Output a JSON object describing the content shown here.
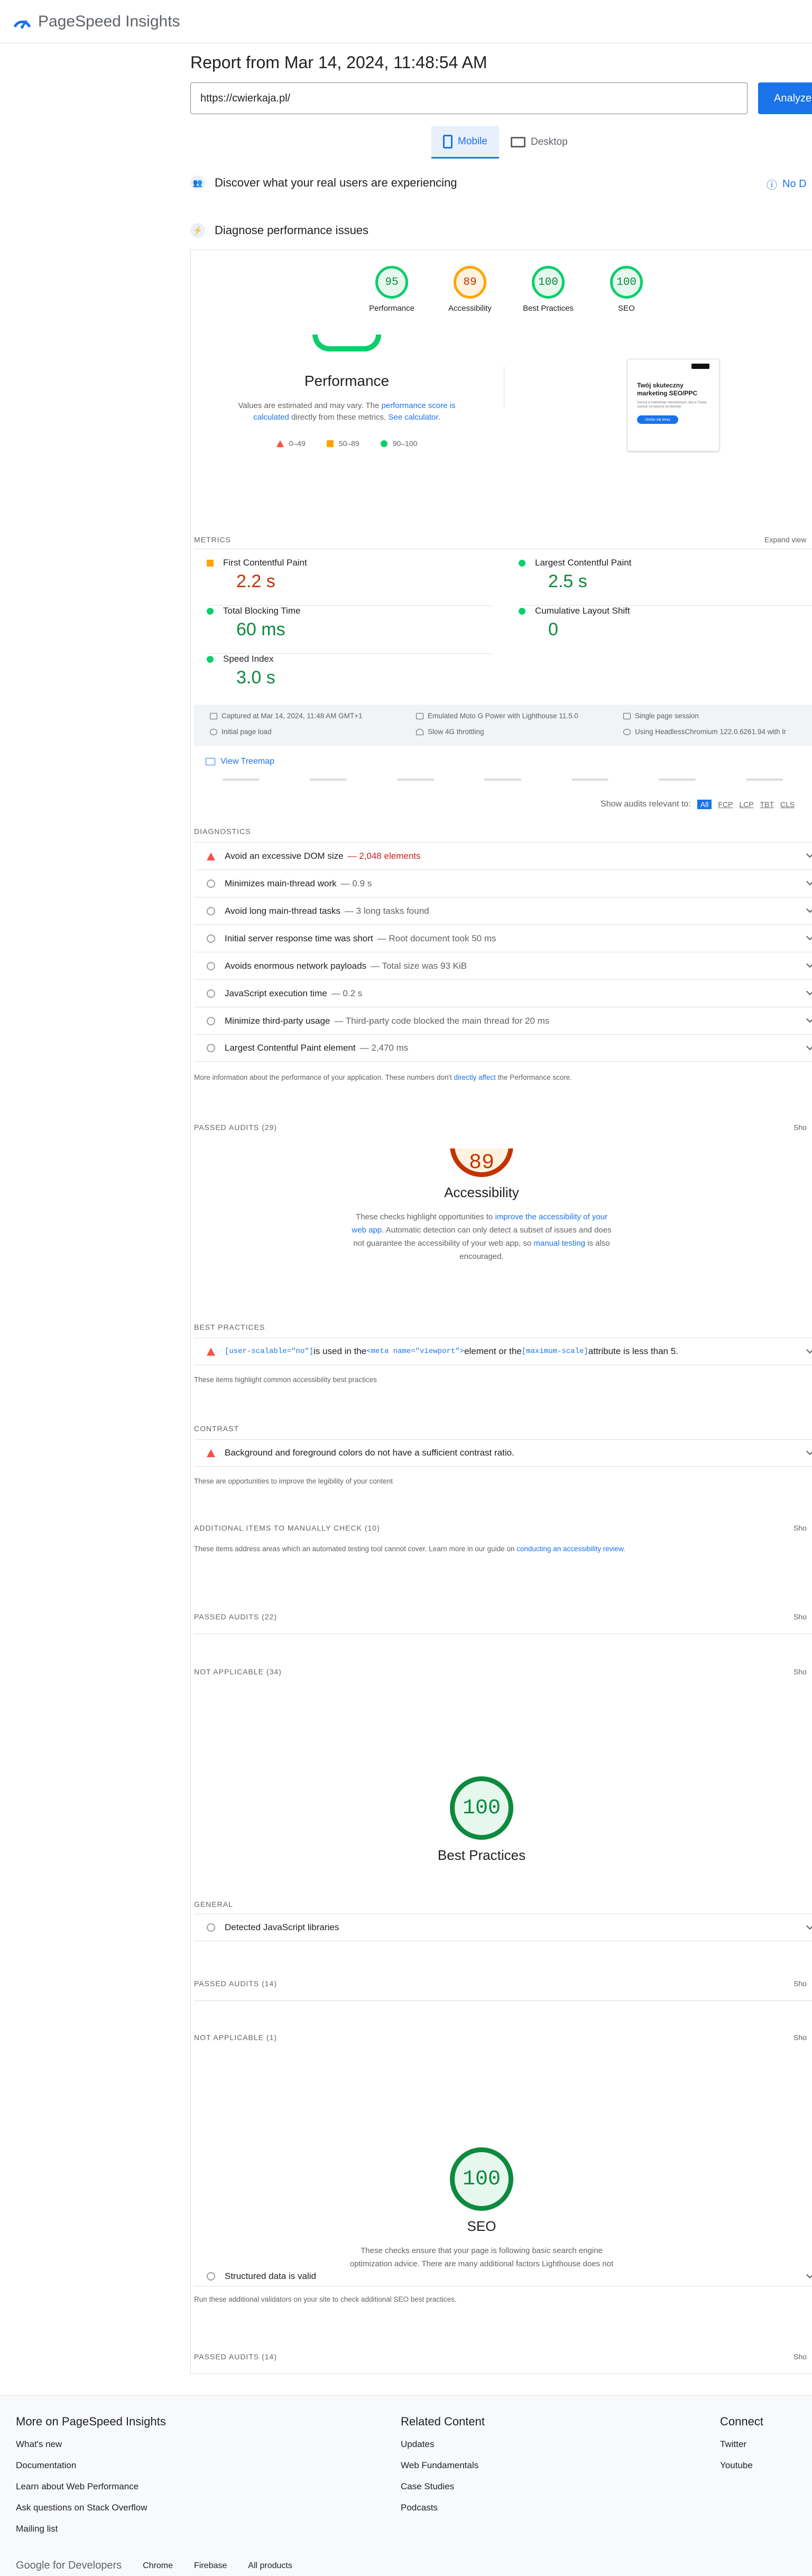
{
  "header": {
    "title": "PageSpeed Insights"
  },
  "report": {
    "title": "Report from Mar 14, 2024, 11:48:54 AM",
    "url_value": "https://cwierkaja.pl/",
    "analyze_label": "Analyze",
    "tabs": [
      {
        "label": "Mobile"
      },
      {
        "label": "Desktop"
      }
    ]
  },
  "sections": {
    "real_users": "Discover what your real users are experiencing",
    "no_data": "No D",
    "diagnose": "Diagnose performance issues"
  },
  "scores": [
    {
      "label": "Performance",
      "value": "95"
    },
    {
      "label": "Accessibility",
      "value": "89"
    },
    {
      "label": "Best Practices",
      "value": "100"
    },
    {
      "label": "SEO",
      "value": "100"
    }
  ],
  "performance": {
    "title": "Performance",
    "desc_a": "Values are estimated and may vary. The ",
    "desc_link1": "performance score is calculated",
    "desc_b": " directly from these metrics. ",
    "desc_link2": "See calculator",
    "desc_c": ".",
    "legend": [
      "0–49",
      "50–89",
      "90–100"
    ]
  },
  "thumbnail": {
    "title": "Twój skuteczny marketing SEO/PPC",
    "body": "Zacznij w marketingu internetowym, aby w Twojej szansie na dotarcie do klientów",
    "button": "Umów się teraz"
  },
  "metrics": {
    "label": "METRICS",
    "expand": "Expand view",
    "items": [
      {
        "name": "First Contentful Paint",
        "value": "2.2 s"
      },
      {
        "name": "Largest Contentful Paint",
        "value": "2.5 s"
      },
      {
        "name": "Total Blocking Time",
        "value": "60 ms"
      },
      {
        "name": "Cumulative Layout Shift",
        "value": "0"
      },
      {
        "name": "Speed Index",
        "value": "3.0 s"
      }
    ]
  },
  "run_info": {
    "captured": "Captured at Mar 14, 2024, 11:48 AM GMT+1",
    "initial": "Initial page load",
    "device": "Emulated Moto G Power with Lighthouse 11.5.0",
    "throttle": "Slow 4G throttling",
    "session": "Single page session",
    "browser": "Using HeadlessChromium 122.0.6261.94 with lr"
  },
  "treemap": "View Treemap",
  "filter": {
    "label": "Show audits relevant to:",
    "options": [
      "All",
      "FCP",
      "LCP",
      "TBT",
      "CLS"
    ]
  },
  "diagnostics": {
    "label": "DIAGNOSTICS",
    "items": [
      {
        "title": "Avoid an excessive DOM size",
        "detail": "— 2,048 elements"
      },
      {
        "title": "Minimizes main-thread work",
        "detail": "— 0.9 s"
      },
      {
        "title": "Avoid long main-thread tasks",
        "detail": "— 3 long tasks found"
      },
      {
        "title": "Initial server response time was short",
        "detail": "— Root document took 50 ms"
      },
      {
        "title": "Avoids enormous network payloads",
        "detail": "— Total size was 93 KiB"
      },
      {
        "title": "JavaScript execution time",
        "detail": "— 0.2 s"
      },
      {
        "title": "Minimize third-party usage",
        "detail": "— Third-party code blocked the main thread for 20 ms"
      },
      {
        "title": "Largest Contentful Paint element",
        "detail": "— 2,470 ms"
      }
    ],
    "note_a": "More information about the performance of your application. These numbers don't ",
    "note_link": "directly affect",
    "note_b": " the Performance score."
  },
  "passed_perf": {
    "label": "PASSED AUDITS (29)",
    "show": "Sho"
  },
  "accessibility": {
    "score": "89",
    "title": "Accessibility",
    "desc_a": "These checks highlight opportunities to ",
    "desc_link1": "improve the accessibility of your web app",
    "desc_b": ". Automatic detection can only detect a subset of issues and does not guarantee the accessibility of your web app, so ",
    "desc_link2": "manual testing",
    "desc_c": " is also encouraged.",
    "best_label": "BEST PRACTICES",
    "bp_code1": "[user-scalable=\"no\"]",
    "bp_text1": " is used in the ",
    "bp_code2": "<meta name=\"viewport\">",
    "bp_text2": " element or the ",
    "bp_code3": "[maximum-scale]",
    "bp_text3": " attribute is less than 5.",
    "bp_note": "These items highlight common accessibility best practices",
    "contrast_label": "CONTRAST",
    "contrast_item": "Background and foreground colors do not have a sufficient contrast ratio.",
    "contrast_note": "These are opportunities to improve the legibility of your content",
    "manual_label": "ADDITIONAL ITEMS TO MANUALLY CHECK (10)",
    "manual_note_a": "These items address areas which an automated testing tool cannot cover. Learn more in our guide on ",
    "manual_note_link": "conducting an accessibility review",
    "manual_note_b": ".",
    "passed": "PASSED AUDITS (22)",
    "na": "NOT APPLICABLE (34)",
    "show": "Sho"
  },
  "best_practices": {
    "score": "100",
    "title": "Best Practices",
    "general_label": "GENERAL",
    "item": "Detected JavaScript libraries",
    "passed": "PASSED AUDITS (14)",
    "na": "NOT APPLICABLE (1)",
    "show": "Sho"
  },
  "seo": {
    "score": "100",
    "title": "SEO",
    "desc": "These checks ensure that your page is following basic search engine optimization advice. There are many additional factors Lighthouse does not score here that may affect your search ranking, including performance on",
    "item": "Structured data is valid",
    "note": "Run these additional validators on your site to check additional SEO best practices.",
    "passed": "PASSED AUDITS (14)",
    "show": "Sho"
  },
  "footer": {
    "col1": {
      "title": "More on PageSpeed Insights",
      "links": [
        "What's new",
        "Documentation",
        "Learn about Web Performance",
        "Ask questions on Stack Overflow",
        "Mailing list"
      ]
    },
    "col2": {
      "title": "Related Content",
      "links": [
        "Updates",
        "Web Fundamentals",
        "Case Studies",
        "Podcasts"
      ]
    },
    "col3": {
      "title": "Connect",
      "links": [
        "Twitter",
        "Youtube"
      ]
    },
    "bottom": {
      "brand": "Google for Developers",
      "links": [
        "Chrome",
        "Firebase",
        "All products"
      ]
    }
  },
  "colors": {
    "accent": "#1a73e8",
    "good": "#0cce6b",
    "average": "#ffa400",
    "poor": "#ff4e42"
  }
}
